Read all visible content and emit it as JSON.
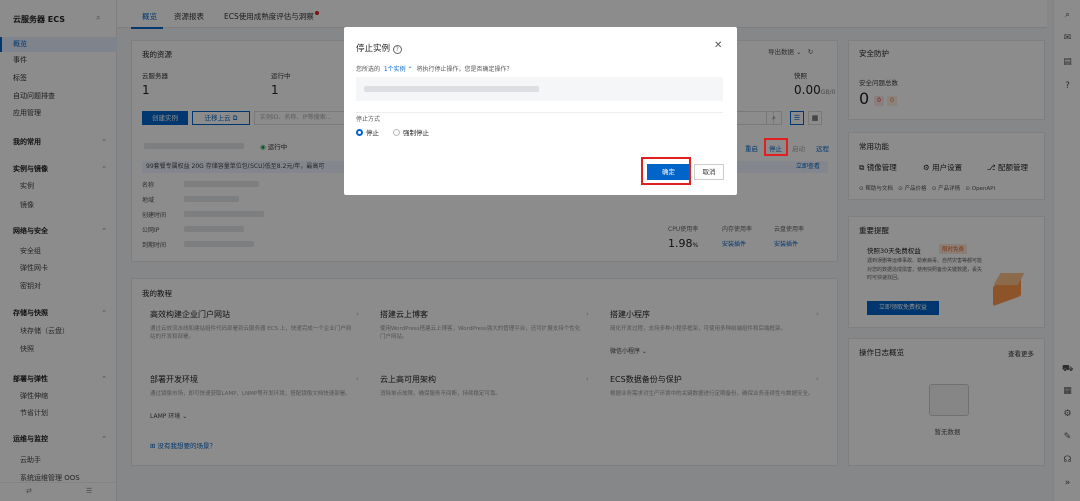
{
  "sidebar": {
    "title": "云服务器 ECS",
    "items": [
      {
        "label": "概览",
        "type": "item",
        "active": true
      },
      {
        "label": "事件",
        "type": "item"
      },
      {
        "label": "标签",
        "type": "item"
      },
      {
        "label": "自动问题排查",
        "type": "item"
      },
      {
        "label": "应用管理",
        "type": "item"
      },
      {
        "label": "我的常用",
        "type": "group"
      },
      {
        "label": "实例与镜像",
        "type": "group"
      },
      {
        "label": "实例",
        "type": "sub"
      },
      {
        "label": "镜像",
        "type": "sub"
      },
      {
        "label": "网络与安全",
        "type": "group"
      },
      {
        "label": "安全组",
        "type": "sub"
      },
      {
        "label": "弹性网卡",
        "type": "sub"
      },
      {
        "label": "密钥对",
        "type": "sub"
      },
      {
        "label": "存储与快照",
        "type": "group"
      },
      {
        "label": "块存储（云盘）",
        "type": "sub"
      },
      {
        "label": "快照",
        "type": "sub"
      },
      {
        "label": "部署与弹性",
        "type": "group"
      },
      {
        "label": "弹性伸缩",
        "type": "sub"
      },
      {
        "label": "节省计划",
        "type": "sub"
      },
      {
        "label": "运维与监控",
        "type": "group"
      },
      {
        "label": "云助手",
        "type": "sub"
      },
      {
        "label": "系统运维管理 OOS",
        "type": "sub"
      }
    ]
  },
  "tabs": [
    "概览",
    "资源报表",
    "ECS使用成熟度评估与洞察"
  ],
  "resources": {
    "title": "我的资源",
    "export_label": "导出数据",
    "stats": [
      {
        "label": "云服务器",
        "value": "1"
      },
      {
        "label": "运行中",
        "value": "1"
      },
      {
        "label": "快照",
        "value": "0.00",
        "unit": "GB/0"
      }
    ],
    "create_btn": "创建实例",
    "migrate_btn": "迁移上云",
    "search_placeholder": "实例ID、名称、IP等搜索...",
    "status": "运行中",
    "actions": [
      "重启",
      "停止",
      "启动",
      "远程"
    ],
    "notice": "99套餐专属权益 20G 存储容量单位包(SCU)低至8.2元/年，最高可",
    "notice_link": "立即查看",
    "fields": [
      "名称",
      "地域",
      "创建时间",
      "公网IP",
      "到期时间"
    ],
    "metrics": [
      {
        "label": "CPU使用率",
        "value": "1.98",
        "unit": "%"
      },
      {
        "label": "内存使用率",
        "link": "安装插件"
      },
      {
        "label": "云盘使用率",
        "link": "安装插件"
      }
    ]
  },
  "tutorials": {
    "title": "我的教程",
    "items": [
      {
        "title": "高效构建企业门户网站",
        "desc": "通过云效流水线和建站组件代码部署到云服务器 ECS 上，快速完成一个企业门户网站的开发和部署。"
      },
      {
        "title": "搭建云上博客",
        "desc": "使用WordPress搭建云上博客，WordPress强大的管理平台，还可扩展支持个性化门户网站。"
      },
      {
        "title": "搭建小程序",
        "desc": "简化开发过程，支持多种小程序框架，可使用多种前端组件和后端框架。",
        "extra": "微信小程序"
      },
      {
        "title": "部署开发环境",
        "desc": "通过镜像市场，即可快速获取LAMP、LNMP等开发环境，搭配镜像文档快速部署。",
        "extra": "LAMP 环境"
      },
      {
        "title": "云上高可用架构",
        "desc": "消除单点故障，确保服务不间断，持续稳定可靠。"
      },
      {
        "title": "ECS数据备份与保护",
        "desc": "根据业务需求对生产环境中的关键数据进行定期备份，确保业务连续性与数据安全。"
      }
    ],
    "footer_link": "没有我想要的场景？"
  },
  "right": {
    "security_title": "安全防护",
    "security_label": "安全问题总数",
    "security_value": "0",
    "security_badges": [
      "0",
      "0"
    ],
    "common_title": "常用功能",
    "common_items": [
      "镜像管理",
      "用户设置",
      "配额管理"
    ],
    "common_links": [
      "帮助与文档",
      "产品价格",
      "产品详情",
      "OpenAPI"
    ],
    "promo_title": "重要提醒",
    "promo_heading": "快照30天免费权益",
    "promo_tag": "限时免费",
    "promo_text": "遇到误删等运维事故、勒索病毒、自然灾害等都可能对您的数据造成损害，使用快照备份关键数据，丢失时可快速找回。",
    "promo_btn": "立即领取免费权益",
    "log_title": "操作日志概览",
    "log_link": "查看更多",
    "log_empty": "暂无数据"
  },
  "modal": {
    "title": "停止实例",
    "prompt": "您所选的",
    "selected_link": "1个实例",
    "prompt_tail": "将执行停止操作，您是否确定操作？",
    "mode_label": "停止方式",
    "options": [
      "停止",
      "强制停止"
    ],
    "selected_option": "停止",
    "confirm": "确定",
    "cancel": "取消"
  }
}
